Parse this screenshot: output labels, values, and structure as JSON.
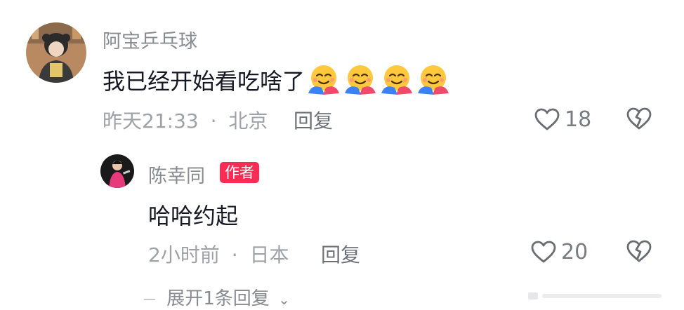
{
  "colors": {
    "username": "#8a8b91",
    "content": "#161823",
    "meta": "#a0a1a7",
    "author_badge_bg": "#fe2c55",
    "author_badge_text": "#ffffff"
  },
  "comment": {
    "username": "阿宝乒乓球",
    "text": "我已经开始看吃啥了",
    "emojis": [
      "hugging-face-emoji",
      "hugging-face-emoji",
      "hugging-face-emoji",
      "hugging-face-emoji"
    ],
    "time": "昨天21:33",
    "separator": "·",
    "location": "北京",
    "reply_label": "回复",
    "like_count": "18",
    "like_icon": "heart-outline-icon",
    "dislike_icon": "broken-heart-icon"
  },
  "reply": {
    "username": "陈幸同",
    "badge": "作者",
    "text": "哈哈约起",
    "time": "2小时前",
    "separator": "·",
    "location": "日本",
    "reply_label": "回复",
    "like_count": "20",
    "like_icon": "heart-outline-icon",
    "dislike_icon": "broken-heart-icon"
  },
  "expand": {
    "label": "展开1条回复",
    "icon": "chevron-down-icon"
  }
}
